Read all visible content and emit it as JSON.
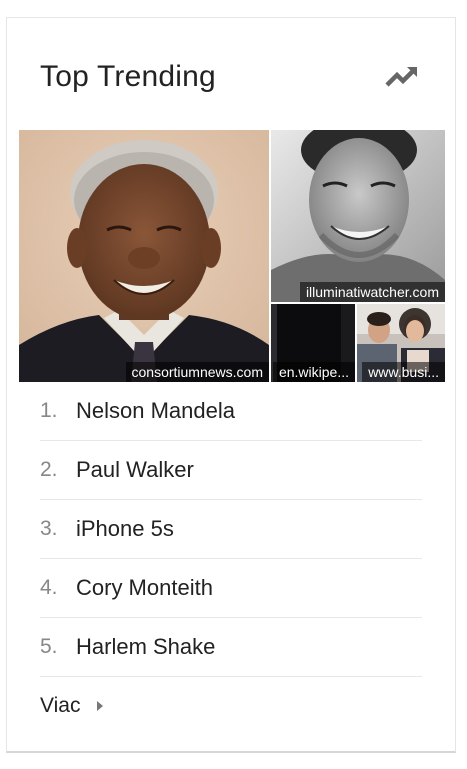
{
  "header": {
    "title": "Top Trending",
    "trend_icon": "trending-up-icon"
  },
  "images": [
    {
      "caption": "consortiumnews.com"
    },
    {
      "caption": "illuminatiwatcher.com"
    },
    {
      "caption": "en.wikipe..."
    },
    {
      "caption": "www.busi..."
    }
  ],
  "trending": [
    {
      "rank": "1.",
      "name": "Nelson Mandela"
    },
    {
      "rank": "2.",
      "name": "Paul Walker"
    },
    {
      "rank": "3.",
      "name": "iPhone 5s"
    },
    {
      "rank": "4.",
      "name": "Cory Monteith"
    },
    {
      "rank": "5.",
      "name": "Harlem Shake"
    }
  ],
  "more": {
    "label": "Viac",
    "icon": "triangle-right-icon"
  }
}
